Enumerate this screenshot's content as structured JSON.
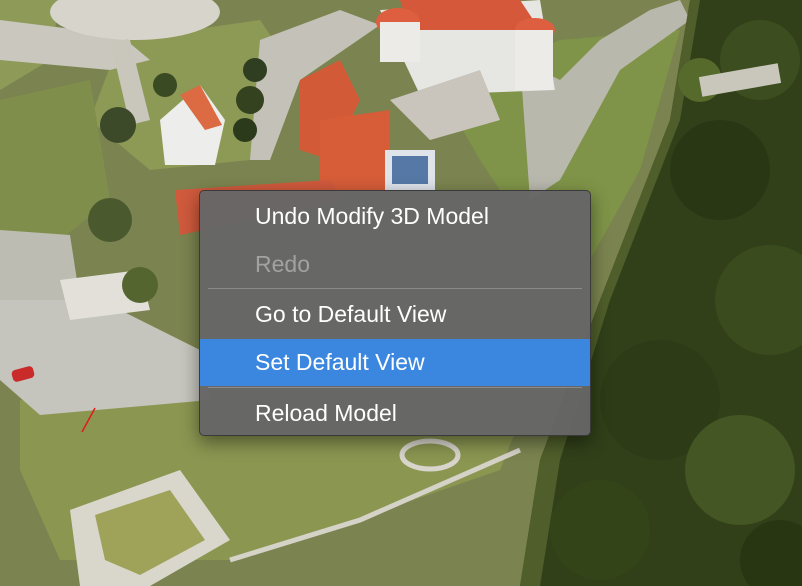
{
  "context_menu": {
    "items": [
      {
        "label": "Undo Modify 3D Model",
        "enabled": true
      },
      {
        "label": "Redo",
        "enabled": false
      },
      {
        "label": "Go to Default View",
        "enabled": true
      },
      {
        "label": "Set Default View",
        "enabled": true,
        "highlighted": true
      },
      {
        "label": "Reload Model",
        "enabled": true
      }
    ],
    "highlight_color": "#3b87e0"
  },
  "viewport": {
    "content": "aerial-3d-model-of-castle"
  }
}
